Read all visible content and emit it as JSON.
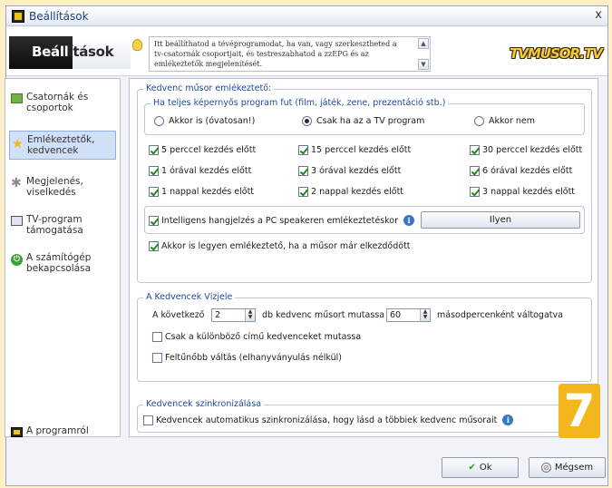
{
  "window": {
    "title": "Beállítások",
    "close_label": "x"
  },
  "header": {
    "logo_part1": "Beáll",
    "logo_part2": "ítások",
    "info_text": "Itt beállíthatod a tévéprogramodat, ha van, vagy szerkesztheted a tv-csatornák csoportjait, és testreszabhatod a zzEPG és az emlékeztetők megjelenítését.",
    "brand": "TVMUSOR.TV"
  },
  "sidebar": {
    "items": [
      {
        "label": "Csatornák és csoportok",
        "icon": "channels-icon",
        "active": false
      },
      {
        "label": "Emlékeztetők, kedvencek",
        "icon": "star-icon",
        "active": true
      },
      {
        "label": "Megjelenés, viselkedés",
        "icon": "gear-icon",
        "active": false
      },
      {
        "label": "TV-program támogatása",
        "icon": "tv-icon",
        "active": false
      },
      {
        "label": "A számítógép bekapcsolása",
        "icon": "power-icon",
        "active": false
      }
    ],
    "about_label": "A programról"
  },
  "reminders": {
    "legend": "Kedvenc műsor emlékeztető:",
    "fullscreen_legend": "Ha teljes képernyős program fut (film, játék, zene, prezentáció stb.)",
    "radios": [
      {
        "label": "Akkor is (óvatosan!)",
        "checked": false
      },
      {
        "label": "Csak ha az a TV program",
        "checked": true
      },
      {
        "label": "Akkor nem",
        "checked": false
      }
    ],
    "time_options": [
      {
        "label": "5 perccel kezdés előtt",
        "checked": true
      },
      {
        "label": "15 perccel kezdés előtt",
        "checked": true
      },
      {
        "label": "30 perccel kezdés előtt",
        "checked": true
      },
      {
        "label": "1 órával kezdés előtt",
        "checked": true
      },
      {
        "label": "3 órával kezdés előtt",
        "checked": true
      },
      {
        "label": "6 órával kezdés előtt",
        "checked": true
      },
      {
        "label": "1 nappal kezdés előtt",
        "checked": true
      },
      {
        "label": "2 nappal kezdés előtt",
        "checked": true
      },
      {
        "label": "3 nappal kezdés előtt",
        "checked": true
      }
    ],
    "speaker_label": "Intelligens hangjelzés a PC speakeren emlékeztetéskor",
    "speaker_checked": true,
    "sound_button": "Ilyen",
    "late_label": "Akkor is legyen emlékeztető, ha a műsor már elkezdődött",
    "late_checked": true
  },
  "favorites_view": {
    "legend": "A Kedvencek Vízjele",
    "prefix": "A következő",
    "count_value": "2",
    "middle": "db kedvenc műsort mutassa",
    "seconds_value": "60",
    "suffix": "másodpercenként váltogatva",
    "distinct_label": "Csak a különböző című kedvenceket mutassa",
    "distinct_checked": false,
    "switch_label": "Feltűnőbb váltás (elhanyványulás nélkül)",
    "switch_checked": false
  },
  "sync": {
    "legend": "Kedvencek szinkronizálása",
    "label": "Kedvencek automatikus szinkronizálása, hogy lásd a többiek kedvenc műsorait",
    "checked": false
  },
  "buttons": {
    "ok": "Ok",
    "cancel": "Mégsem"
  },
  "badge": "7"
}
